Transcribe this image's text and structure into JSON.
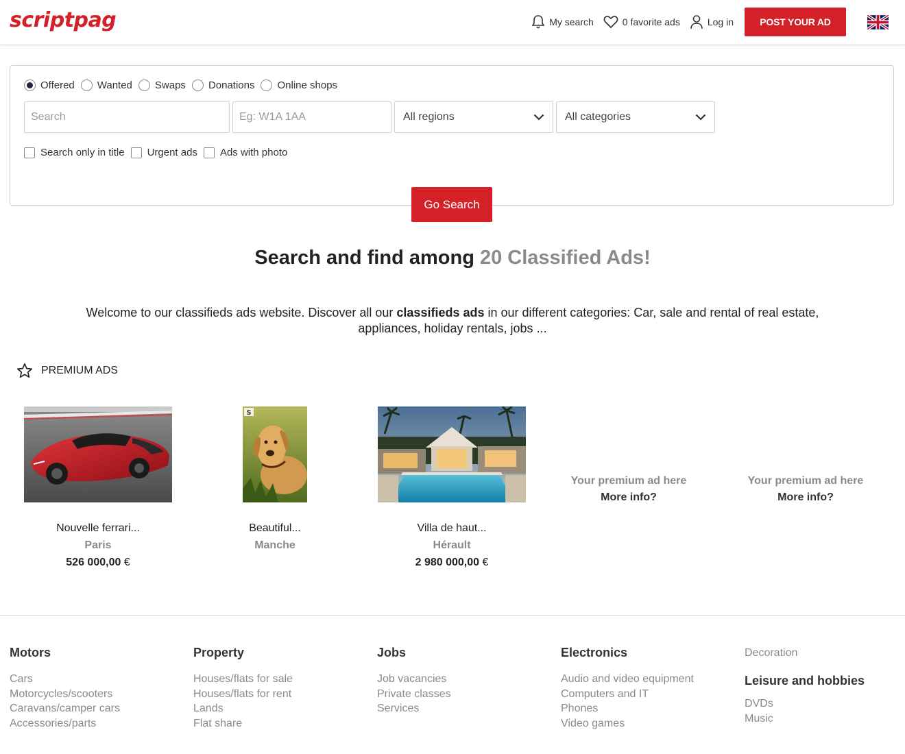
{
  "brand": {
    "logo": "scriptpag",
    "accent_color": "#d42027"
  },
  "header": {
    "my_search": "My search",
    "favorites": "0 favorite ads",
    "login": "Log in",
    "post_ad": "POST YOUR AD",
    "language_icon": "uk-flag-icon"
  },
  "search": {
    "ad_types": [
      {
        "label": "Offered",
        "selected": true
      },
      {
        "label": "Wanted",
        "selected": false
      },
      {
        "label": "Swaps",
        "selected": false
      },
      {
        "label": "Donations",
        "selected": false
      },
      {
        "label": "Online shops",
        "selected": false
      }
    ],
    "keyword_placeholder": "Search",
    "postcode_placeholder": "Eg: W1A 1AA",
    "region_selected": "All regions",
    "category_selected": "All categories",
    "options": [
      "Search only in title",
      "Urgent ads",
      "Ads with photo"
    ],
    "submit": "Go Search"
  },
  "hero": {
    "headline_prefix": "Search and find among",
    "headline_count": "20 Classified Ads!",
    "welcome_before": "Welcome to our classifieds ads website. Discover all our ",
    "welcome_bold": "classifieds ads",
    "welcome_after": " in our different categories: Car, sale and rental of real estate, appliances, holiday rentals, jobs ..."
  },
  "premium": {
    "section_title": "PREMIUM ADS",
    "ads": [
      {
        "title": "Nouvelle ferrari...",
        "location": "Paris",
        "price": "526 000,00",
        "currency": "€",
        "image": "red-sports-car"
      },
      {
        "title": "Beautiful...",
        "location": "Manche",
        "price": "",
        "currency": "",
        "image": "labrador-dog"
      },
      {
        "title": "Villa de haut...",
        "location": "Hérault",
        "price": "2 980 000,00",
        "currency": "€",
        "image": "luxury-villa-pool"
      }
    ],
    "placeholders": [
      {
        "line1": "Your premium ad here",
        "line2": "More info?"
      },
      {
        "line1": "Your premium ad here",
        "line2": "More info?"
      }
    ]
  },
  "footer": {
    "motors": {
      "title": "Motors",
      "links": [
        "Cars",
        "Motorcycles/scooters",
        "Caravans/camper cars",
        "Accessories/parts"
      ]
    },
    "property": {
      "title": "Property",
      "links": [
        "Houses/flats for sale",
        "Houses/flats for rent",
        "Lands",
        "Flat share"
      ]
    },
    "jobs": {
      "title": "Jobs",
      "links": [
        "Job vacancies",
        "Private classes",
        "Services"
      ]
    },
    "electronics": {
      "title": "Electronics",
      "links": [
        "Audio and video equipment",
        "Computers and IT",
        "Phones",
        "Video games"
      ]
    },
    "decoration": "Decoration",
    "leisure": {
      "title": "Leisure and hobbies",
      "links": [
        "DVDs",
        "Music"
      ]
    }
  }
}
